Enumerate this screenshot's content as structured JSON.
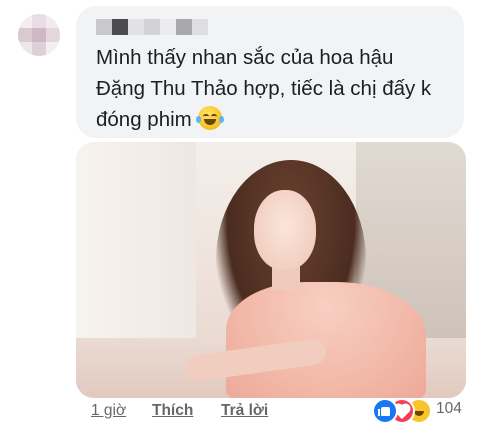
{
  "comment": {
    "text": "Mình thấy nhan sắc của hoa hậu Đặng Thu Thảo hợp, tiếc là chị đấy k đóng phim",
    "emoji": "laugh-cry-emoji"
  },
  "actions": {
    "time": "1 giờ",
    "like": "Thích",
    "reply": "Trả lời"
  },
  "reactions": {
    "types": [
      "like",
      "love",
      "haha"
    ],
    "count": "104"
  },
  "colors": {
    "bubble": "#f2f3f5",
    "text": "#1c1e21",
    "meta": "#65676b",
    "like": "#1877f2",
    "love": "#f33e58",
    "haha": "#f7c52a"
  }
}
